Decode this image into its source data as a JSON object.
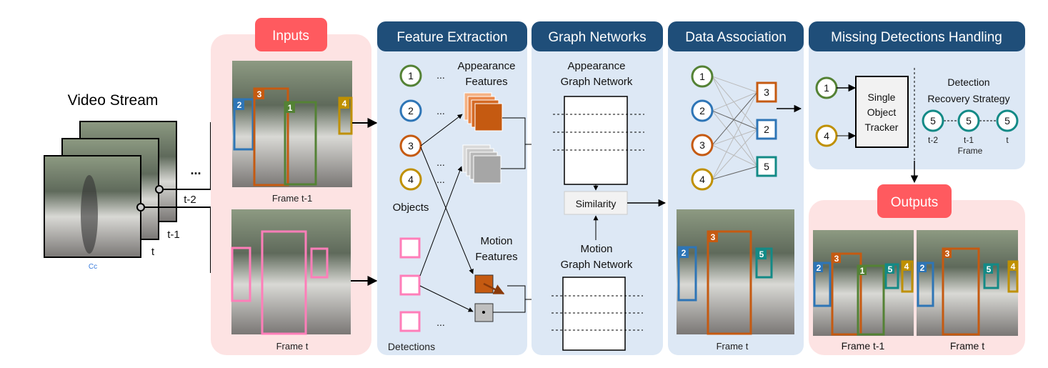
{
  "colors": {
    "panel_blue": "#dde8f5",
    "panel_pink": "#fde3e3",
    "header_blue": "#1f4e79",
    "label_red": "#ff5a5f",
    "green": "#548235",
    "blue": "#2e75b6",
    "orange": "#c55a11",
    "gold": "#bf9000",
    "teal": "#138a86",
    "pink": "#ff7eb9"
  },
  "video_stream": {
    "title": "Video Stream",
    "frames": [
      "t-2",
      "t-1",
      "t"
    ],
    "ellipsis": "...",
    "caption": "Cc"
  },
  "inputs": {
    "label": "Inputs",
    "frame_prev": "Frame t-1",
    "frame_cur": "Frame t",
    "box_ids": [
      "3",
      "2",
      "1",
      "4"
    ]
  },
  "feature_extraction": {
    "title": "Feature Extraction",
    "objects": [
      "1",
      "2",
      "3",
      "4"
    ],
    "objects_label": "Objects",
    "appearance_label": [
      "Appearance",
      "Features"
    ],
    "motion_label": [
      "Motion",
      "Features"
    ],
    "detections_label": "Detections",
    "ellipsis": "..."
  },
  "graph_networks": {
    "title": "Graph Networks",
    "appearance_label": [
      "Appearance",
      "Graph Network"
    ],
    "similarity": "Similarity",
    "motion_label": [
      "Motion",
      "Graph Network"
    ]
  },
  "data_association": {
    "title": "Data Association",
    "left": [
      "1",
      "2",
      "3",
      "4"
    ],
    "right": [
      "3",
      "2",
      "5"
    ],
    "frame_label": "Frame t",
    "box_ids": [
      "3",
      "2",
      "5"
    ]
  },
  "missing_detections": {
    "title": "Missing Detections Handling",
    "inputs": [
      "1",
      "4"
    ],
    "tracker": [
      "Single",
      "Object",
      "Tracker"
    ],
    "recovery_title": [
      "Detection",
      "Recovery Strategy"
    ],
    "nodes": [
      "5",
      "5",
      "5"
    ],
    "node_labels": [
      "t-2",
      "t-1",
      "t"
    ],
    "axis_label": "Frame"
  },
  "outputs": {
    "label": "Outputs",
    "frame_prev": "Frame t-1",
    "frame_cur": "Frame t",
    "box_ids_prev": [
      "3",
      "2",
      "1",
      "5",
      "4"
    ],
    "box_ids_cur": [
      "3",
      "2",
      "5",
      "4"
    ]
  }
}
